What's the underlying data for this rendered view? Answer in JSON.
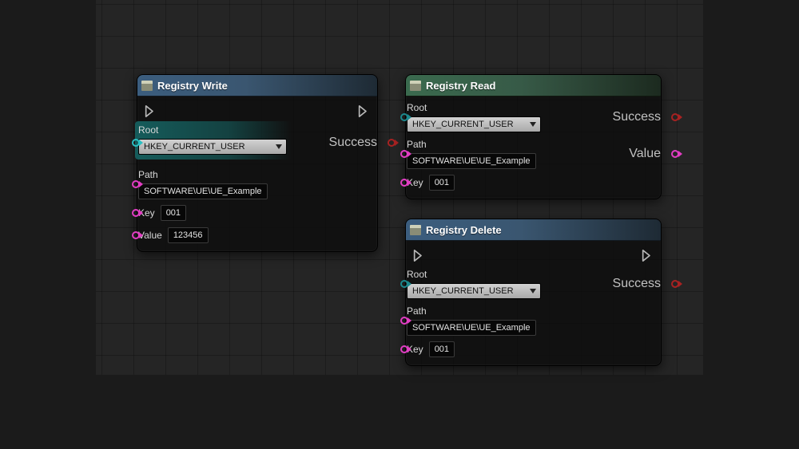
{
  "nodes": {
    "write": {
      "title": "Registry Write",
      "root_label": "Root",
      "root_value": "HKEY_CURRENT_USER",
      "path_label": "Path",
      "path_value": "SOFTWARE\\UE\\UE_Example",
      "key_label": "Key",
      "key_value": "001",
      "value_label": "Value",
      "value_value": "123456",
      "success_label": "Success"
    },
    "read": {
      "title": "Registry Read",
      "root_label": "Root",
      "root_value": "HKEY_CURRENT_USER",
      "path_label": "Path",
      "path_value": "SOFTWARE\\UE\\UE_Example",
      "key_label": "Key",
      "key_value": "001",
      "success_label": "Success",
      "value_out_label": "Value"
    },
    "del": {
      "title": "Registry Delete",
      "root_label": "Root",
      "root_value": "HKEY_CURRENT_USER",
      "path_label": "Path",
      "path_value": "SOFTWARE\\UE\\UE_Example",
      "key_label": "Key",
      "key_value": "001",
      "success_label": "Success"
    }
  }
}
